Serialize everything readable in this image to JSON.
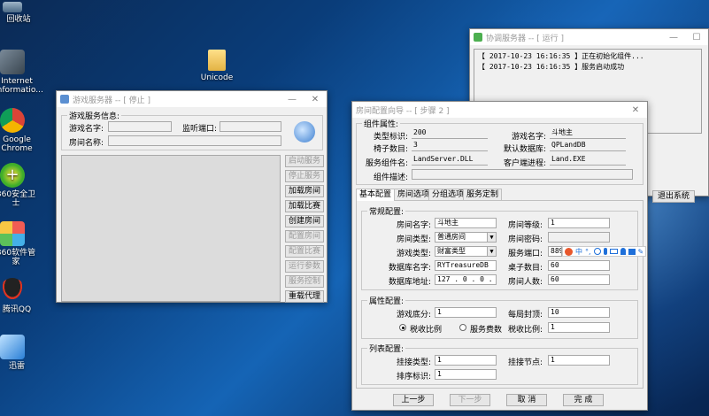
{
  "desktop": {
    "icons": [
      {
        "label": "回收站",
        "icon": "recycle-bin-icon"
      },
      {
        "label": "Internet Informatio...",
        "icon": "iis-icon"
      },
      {
        "label": "Google Chrome",
        "icon": "chrome-icon"
      },
      {
        "label": "360安全卫士",
        "icon": "360-safe-icon"
      },
      {
        "label": "360软件管家",
        "icon": "software-manager-icon"
      },
      {
        "label": "腾讯QQ",
        "icon": "qq-icon"
      },
      {
        "label": "迅雷",
        "icon": "thunder-icon"
      },
      {
        "label": "Unicode",
        "icon": "folder-icon"
      }
    ]
  },
  "game_server_window": {
    "title": "游戏服务器 -- [ 停止 ]",
    "group_title": "游戏服务信息:",
    "game_name_label": "游戏名字:",
    "listen_port_label": "监听端口:",
    "room_name_label": "房间名称:",
    "buttons": [
      {
        "label": "启动服务",
        "enabled": false
      },
      {
        "label": "停止服务",
        "enabled": false
      },
      {
        "label": "加载房间",
        "enabled": true
      },
      {
        "label": "加载比赛",
        "enabled": true
      },
      {
        "label": "创建房间",
        "enabled": true
      },
      {
        "label": "配置房间",
        "enabled": false
      },
      {
        "label": "配置比赛",
        "enabled": false
      },
      {
        "label": "运行参数",
        "enabled": false
      },
      {
        "label": "服务控制",
        "enabled": false
      },
      {
        "label": "重载代理",
        "enabled": true
      }
    ]
  },
  "coordinator_window": {
    "title": "协调服务器 -- [ 运行 ]",
    "log": [
      "【 2017-10-23 16:16:35 】正在初始化组件...",
      "【 2017-10-23 16:16:35 】服务启动成功"
    ],
    "exit_button": "退出系统"
  },
  "room_wizard": {
    "title": "房间配置向导 -- [ 步骤 2 ]",
    "component": {
      "group_title": "组件属性:",
      "type_id_label": "类型标识:",
      "type_id": "200",
      "game_name_label": "游戏名字:",
      "game_name": "斗地主",
      "table_count_label": "椅子数目:",
      "table_count": "3",
      "default_db_label": "默认数据库:",
      "default_db": "QPLandDB",
      "service_component_label": "服务组件名:",
      "service_component": "LandServer.DLL",
      "client_process_label": "客户端进程:",
      "client_process": "Land.EXE",
      "component_desc_label": "组件描述:",
      "component_desc": ""
    },
    "tabs": [
      "基本配置",
      "房间选项",
      "分组选项",
      "服务定制"
    ],
    "general": {
      "group_title": "常规配置:",
      "room_name_label": "房间名字:",
      "room_name": "斗地主",
      "room_level_label": "房间等级:",
      "room_level": "1",
      "room_type_label": "房间类型:",
      "room_type": "普通房间",
      "room_password_label": "房间密码:",
      "room_password": "",
      "game_type_label": "游戏类型:",
      "game_type": "财富类型",
      "service_port_label": "服务端口:",
      "service_port": "889",
      "db_name_label": "数据库名字:",
      "db_name": "RYTreasureDB",
      "table_num_label": "桌子数目:",
      "table_num": "60",
      "db_addr_label": "数据库地址:",
      "db_addr": "127 . 0 . 0 . 1",
      "room_people_label": "房间人数:",
      "room_people": "60"
    },
    "attributes": {
      "group_title": "属性配置:",
      "base_score_label": "游戏底分:",
      "base_score": "1",
      "daily_cap_label": "每局封顶:",
      "daily_cap": "10",
      "radio_tax_ratio": "税收比例",
      "radio_service_fee": "服务费数",
      "tax_ratio_label": "税收比例:",
      "tax_ratio": "1"
    },
    "list": {
      "group_title": "列表配置:",
      "mount_type_label": "挂接类型:",
      "mount_type": "1",
      "mount_node_label": "挂接节点:",
      "mount_node": "1",
      "sort_id_label": "排序标识:",
      "sort_id": "1"
    },
    "buttons": {
      "prev": "上一步",
      "next": "下一步",
      "cancel": "取 消",
      "finish": "完 成"
    }
  }
}
